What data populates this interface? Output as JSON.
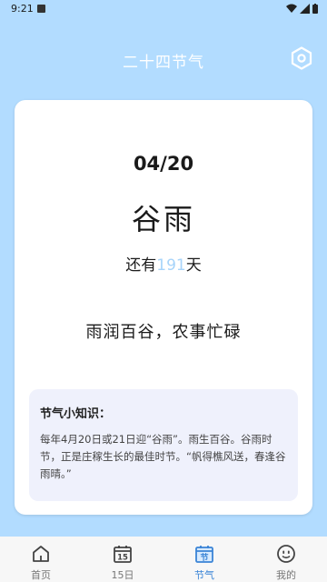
{
  "status": {
    "time": "9:21"
  },
  "header": {
    "title": "二十四节气"
  },
  "term": {
    "date": "04/20",
    "name": "谷雨",
    "countdown_prefix": "还有",
    "countdown_days": "191",
    "countdown_suffix": "天",
    "proverb": "雨润百谷，农事忙碌"
  },
  "knowledge": {
    "title": "节气小知识：",
    "text": "每年4月20日或21日迎“谷雨”。雨生百谷。谷雨时节，正是庄稼生长的最佳时节。“帆得樵风送，春逢谷雨晴。”"
  },
  "nav": {
    "items": [
      {
        "label": "首页",
        "icon": "home-icon"
      },
      {
        "label": "15日",
        "icon": "calendar-icon",
        "icon_text": "15"
      },
      {
        "label": "节气",
        "icon": "solar-term-icon",
        "icon_text": "节",
        "active": true
      },
      {
        "label": "我的",
        "icon": "face-icon"
      }
    ]
  },
  "colors": {
    "background": "#b2dcff",
    "accent": "#3a84d6",
    "countdown_number": "#a7d4fa"
  }
}
